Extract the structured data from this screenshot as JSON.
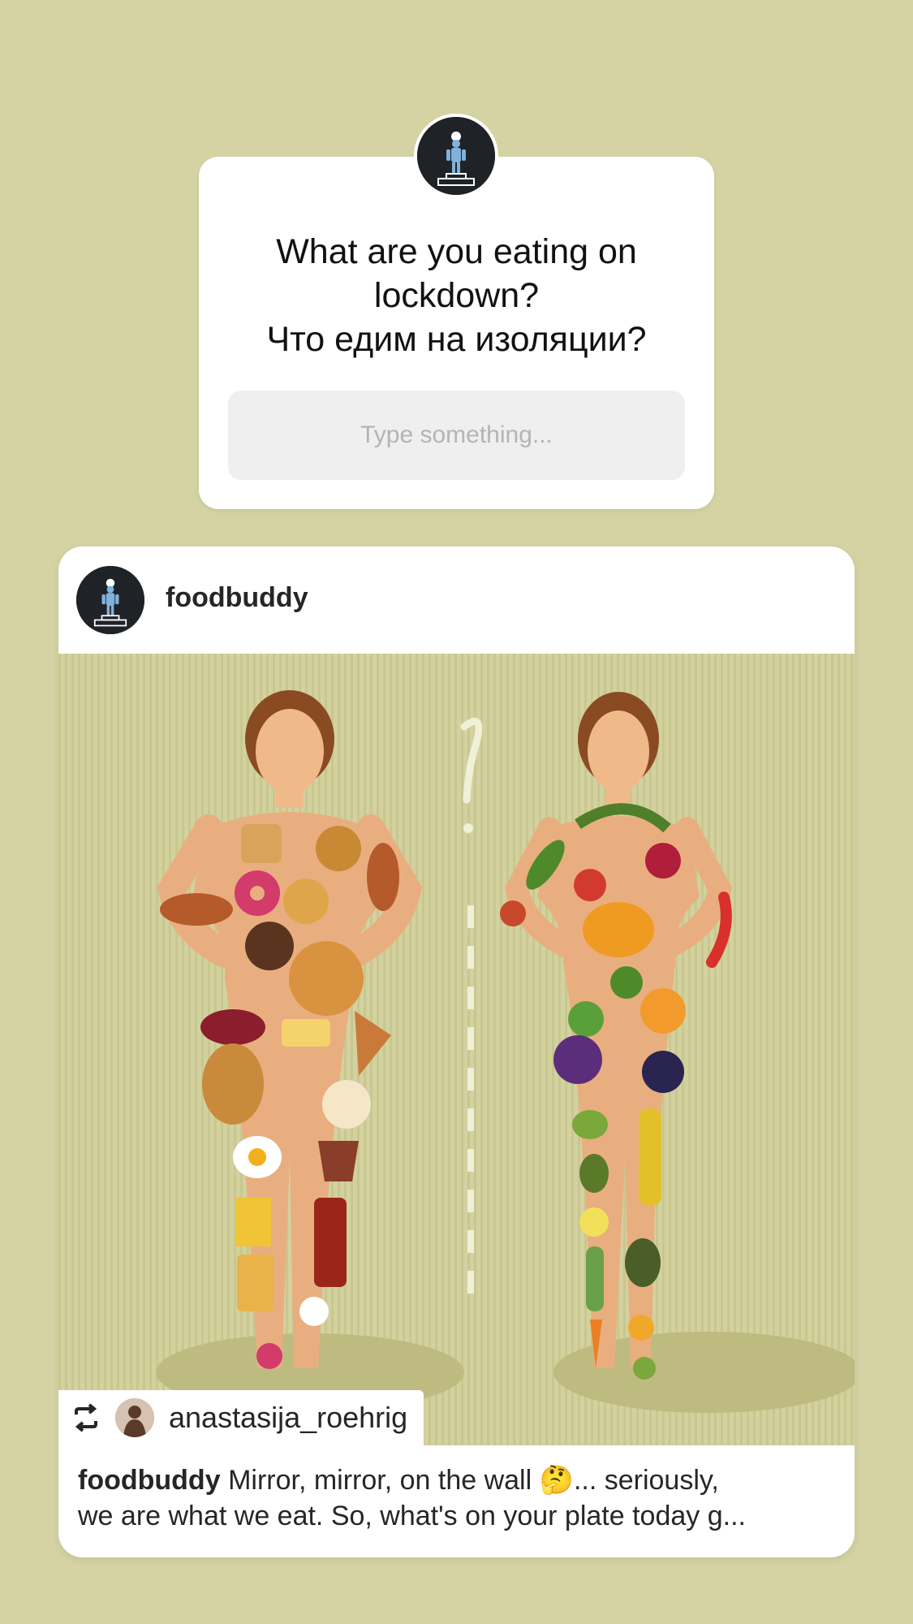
{
  "sticker": {
    "question": "What are you eating on\nlockdown?\nЧто едим на изоляции?",
    "input_placeholder": "Type something..."
  },
  "post": {
    "username": "foodbuddy",
    "image_alt": "?",
    "regram": {
      "username": "anastasija_roehrig"
    },
    "caption": {
      "username": "foodbuddy",
      "line1": "Mirror, mirror, on the wall 🤔... seriously,",
      "line2": "we are what we eat. So, what's on your plate today g..."
    }
  },
  "icons": {
    "regram": "repost-icon",
    "avatar": "chef-podium-icon"
  },
  "colors": {
    "background": "#d5d3a4",
    "card": "#ffffff",
    "input_bg": "#efefef",
    "avatar_bg": "#1f2226",
    "accent_blue": "#7fb2dd"
  }
}
